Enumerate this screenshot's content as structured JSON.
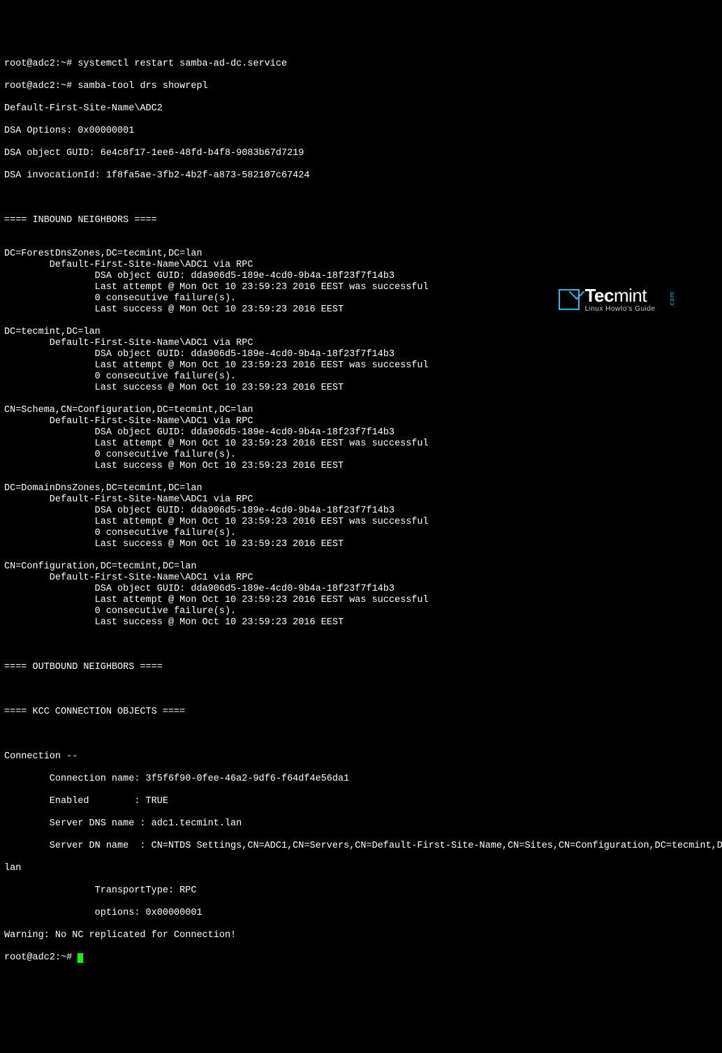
{
  "prompt1": "root@adc2:~# ",
  "cmd1": "systemctl restart samba-ad-dc.service",
  "prompt2": "root@adc2:~# ",
  "cmd2": "samba-tool drs showrepl",
  "header": {
    "site": "Default-First-Site-Name\\ADC2",
    "options": "DSA Options: 0x00000001",
    "guid": "DSA object GUID: 6e4c8f17-1ee6-48fd-b4f8-9083b67d7219",
    "invocation": "DSA invocationId: 1f8fa5ae-3fb2-4b2f-a873-582107c67424"
  },
  "inbound_title": "==== INBOUND NEIGHBORS ====",
  "neighbors": [
    {
      "dn": "DC=ForestDnsZones,DC=tecmint,DC=lan",
      "via": "        Default-First-Site-Name\\ADC1 via RPC",
      "guid": "                DSA object GUID: dda906d5-189e-4cd0-9b4a-18f23f7f14b3",
      "attempt": "                Last attempt @ Mon Oct 10 23:59:23 2016 EEST was successful",
      "failures": "                0 consecutive failure(s).",
      "success": "                Last success @ Mon Oct 10 23:59:23 2016 EEST"
    },
    {
      "dn": "DC=tecmint,DC=lan",
      "via": "        Default-First-Site-Name\\ADC1 via RPC",
      "guid": "                DSA object GUID: dda906d5-189e-4cd0-9b4a-18f23f7f14b3",
      "attempt": "                Last attempt @ Mon Oct 10 23:59:23 2016 EEST was successful",
      "failures": "                0 consecutive failure(s).",
      "success": "                Last success @ Mon Oct 10 23:59:23 2016 EEST"
    },
    {
      "dn": "CN=Schema,CN=Configuration,DC=tecmint,DC=lan",
      "via": "        Default-First-Site-Name\\ADC1 via RPC",
      "guid": "                DSA object GUID: dda906d5-189e-4cd0-9b4a-18f23f7f14b3",
      "attempt": "                Last attempt @ Mon Oct 10 23:59:23 2016 EEST was successful",
      "failures": "                0 consecutive failure(s).",
      "success": "                Last success @ Mon Oct 10 23:59:23 2016 EEST"
    },
    {
      "dn": "DC=DomainDnsZones,DC=tecmint,DC=lan",
      "via": "        Default-First-Site-Name\\ADC1 via RPC",
      "guid": "                DSA object GUID: dda906d5-189e-4cd0-9b4a-18f23f7f14b3",
      "attempt": "                Last attempt @ Mon Oct 10 23:59:23 2016 EEST was successful",
      "failures": "                0 consecutive failure(s).",
      "success": "                Last success @ Mon Oct 10 23:59:23 2016 EEST"
    },
    {
      "dn": "CN=Configuration,DC=tecmint,DC=lan",
      "via": "        Default-First-Site-Name\\ADC1 via RPC",
      "guid": "                DSA object GUID: dda906d5-189e-4cd0-9b4a-18f23f7f14b3",
      "attempt": "                Last attempt @ Mon Oct 10 23:59:23 2016 EEST was successful",
      "failures": "                0 consecutive failure(s).",
      "success": "                Last success @ Mon Oct 10 23:59:23 2016 EEST"
    }
  ],
  "outbound_title": "==== OUTBOUND NEIGHBORS ====",
  "kcc_title": "==== KCC CONNECTION OBJECTS ====",
  "connection": {
    "header": "Connection --",
    "name": "        Connection name: 3f5f6f90-0fee-46a2-9df6-f64df4e56da1",
    "enabled": "        Enabled        : TRUE",
    "dns": "        Server DNS name : adc1.tecmint.lan",
    "dn": "        Server DN name  : CN=NTDS Settings,CN=ADC1,CN=Servers,CN=Default-First-Site-Name,CN=Sites,CN=Configuration,DC=tecmint,DC=",
    "dn2": "lan",
    "transport": "                TransportType: RPC",
    "options": "                options: 0x00000001"
  },
  "warning": "Warning: No NC replicated for Connection!",
  "prompt3": "root@adc2:~# ",
  "watermark": {
    "brand1": "Tec",
    "brand2": "mint",
    "sub": "Linux Howto's Guide",
    "com": ".com"
  }
}
